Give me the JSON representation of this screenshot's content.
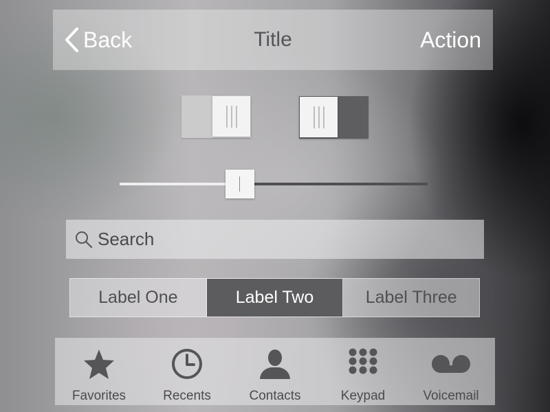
{
  "navbar": {
    "back_label": "Back",
    "title": "Title",
    "action_label": "Action"
  },
  "switches": [
    {
      "state": "on"
    },
    {
      "state": "off"
    }
  ],
  "slider": {
    "value": 0.39
  },
  "search": {
    "placeholder": "Search",
    "value": ""
  },
  "segmented": {
    "segments": [
      "Label One",
      "Label Two",
      "Label Three"
    ],
    "selected_index": 1
  },
  "tabbar": {
    "tabs": [
      {
        "label": "Favorites",
        "icon": "star-icon"
      },
      {
        "label": "Recents",
        "icon": "clock-icon"
      },
      {
        "label": "Contacts",
        "icon": "person-icon"
      },
      {
        "label": "Keypad",
        "icon": "keypad-icon"
      },
      {
        "label": "Voicemail",
        "icon": "voicemail-icon"
      }
    ]
  },
  "colors": {
    "icon": "#555557",
    "selected_segment": "#5c5c5e",
    "switch_off_track": "#5e5e60"
  }
}
